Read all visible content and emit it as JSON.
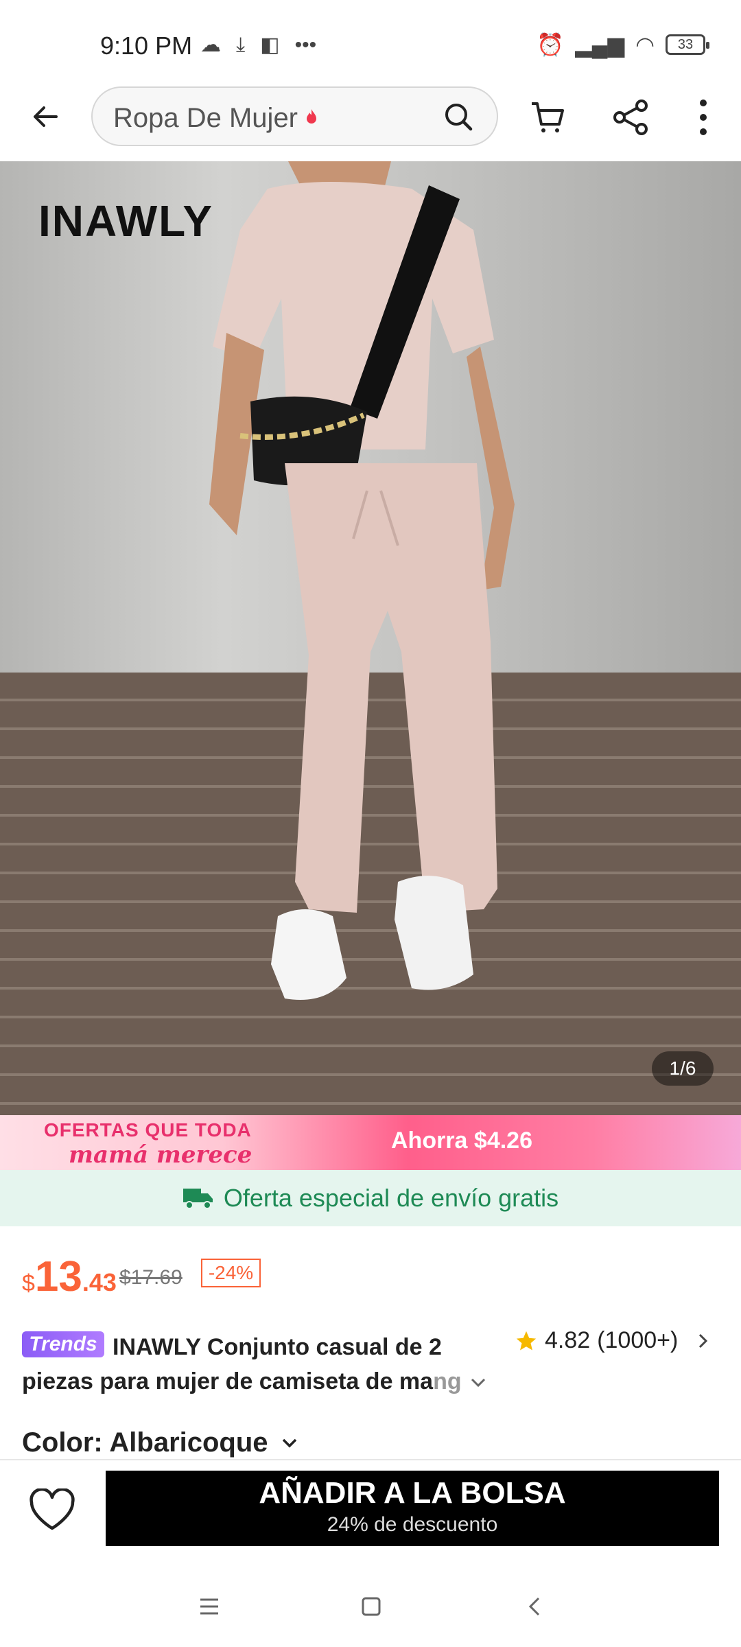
{
  "status_bar": {
    "time": "9:10 PM",
    "battery": "33",
    "more": "•••"
  },
  "header": {
    "search_placeholder": "Ropa De Mujer"
  },
  "product_image": {
    "brand_overlay": "INAWLY",
    "counter": "1/6"
  },
  "promo": {
    "line1": "OFERTAS QUE TODA",
    "line2": "mamá merece",
    "savings": "Ahorra $4.26"
  },
  "shipping": {
    "text": "Oferta especial de envío gratis"
  },
  "price": {
    "currency": "$",
    "whole": "13",
    "decimal": ".43",
    "original": "$17.69",
    "discount": "-24%"
  },
  "product": {
    "badge": "Trends",
    "title_main": "INAWLY Conjunto casual de 2 piezas para mujer de camiseta de ma",
    "title_fade": "ng",
    "rating": "4.82",
    "reviews": "(1000+)"
  },
  "color": {
    "label": "Color: Albaricoque"
  },
  "actions": {
    "add_to_bag": "AÑADIR A LA BOLSA",
    "add_to_bag_sub": "24% de descuento"
  },
  "colors": {
    "accent": "#fa6338",
    "shipping_green": "#1e8a55",
    "promo_pink": "#e8306c",
    "star": "#f6b900"
  }
}
